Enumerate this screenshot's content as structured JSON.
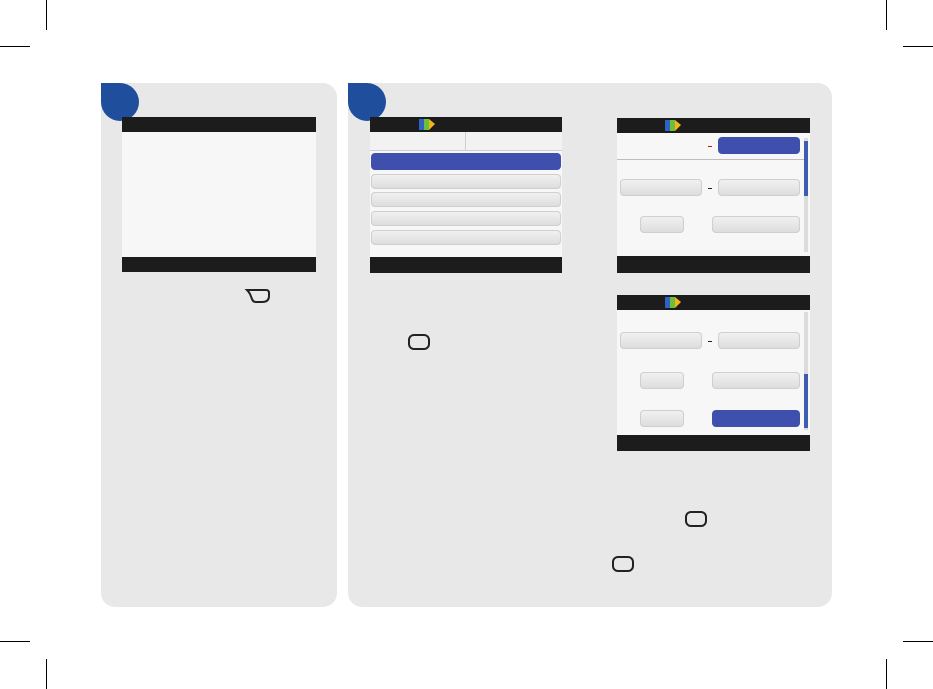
{
  "icons": {
    "panel1_button": "back-button-icon",
    "panel2_button": "ok-button-icon",
    "panel2_button_b": "ok-button-icon",
    "panel2_button_c": "ok-button-icon",
    "logo": "meter-logo-icon"
  },
  "colors": {
    "step_badge": "#1f4e9c",
    "highlight": "#3e4fae",
    "panel_bg": "#e8e8e8",
    "bar": "#1c1c1c"
  }
}
